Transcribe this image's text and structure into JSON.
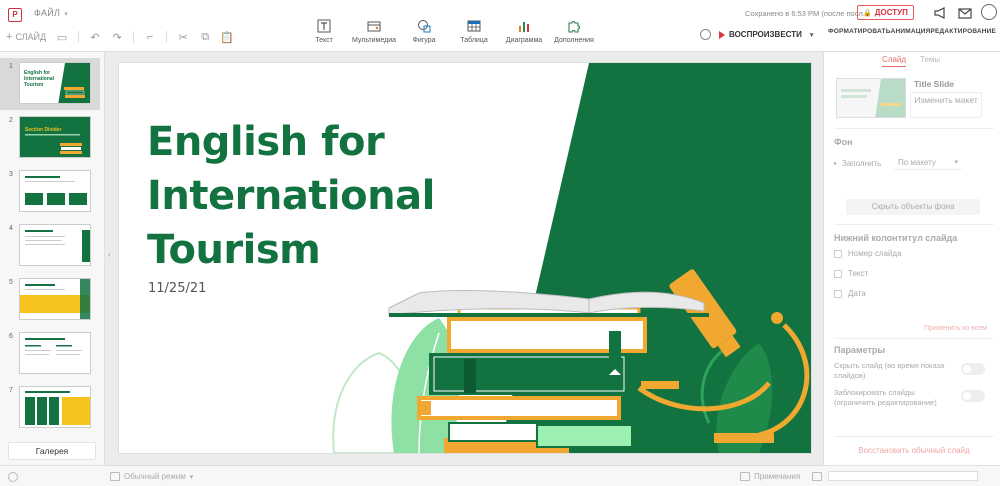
{
  "app": {
    "logo_glyph": "P",
    "file_menu": "ФАЙЛ",
    "save_status": "Сохранено в 6:53 PM (после посл...",
    "access_label": "ДОСТУП",
    "accent_color": "#d9333f",
    "theme_green": "#127341"
  },
  "left_tools": {
    "slide_label": "СЛАЙД"
  },
  "toolbar": {
    "text": "Текст",
    "media": "Мультимедиа",
    "shape": "Фигура",
    "table": "Таблица",
    "chart": "Диаграмма",
    "addons": "Дополнения"
  },
  "play": {
    "label": "ВОСПРОИЗВЕСТИ"
  },
  "right_tabs": {
    "format": "ФОРМАТИРОВАТЬ",
    "animation": "АНИМАЦИЯ",
    "review": "РЕДАКТИРОВАНИЕ"
  },
  "slides": [
    {
      "num": "1",
      "title": "English for International Tourism",
      "selected": true
    },
    {
      "num": "2",
      "title": "Section Divider"
    },
    {
      "num": "3",
      "title": ""
    },
    {
      "num": "4",
      "title": ""
    },
    {
      "num": "5",
      "title": ""
    },
    {
      "num": "6",
      "title": ""
    },
    {
      "num": "7",
      "title": ""
    }
  ],
  "gallery_label": "Галерея",
  "slide": {
    "title": "English for International Tourism",
    "date": "11/25/21"
  },
  "right_panel": {
    "tab_slide": "Слайд",
    "tab_theme": "Темы",
    "layout_name": "Title Slide",
    "change_layout": "Изменить макет",
    "background_title": "Фон",
    "fill_label": "Заполнить",
    "fill_value": "По макету",
    "hide_bg_objects": "Скрыть объекты фона",
    "footer_title": "Нижний колонтитул слайда",
    "slide_number": "Номер слайда",
    "footer": "Текст",
    "date": "Дата",
    "apply_all": "Применить ко всем",
    "params_title": "Параметры",
    "skip_slide": "Скрыть слайд (во время показа слайдов)",
    "lock_slide": "Заблокировать слайды (ограничить редактирование)",
    "reset": "Восстановить обычный слайд"
  },
  "status": {
    "view_mode": "Обычный режим",
    "notes": "Примечания"
  }
}
